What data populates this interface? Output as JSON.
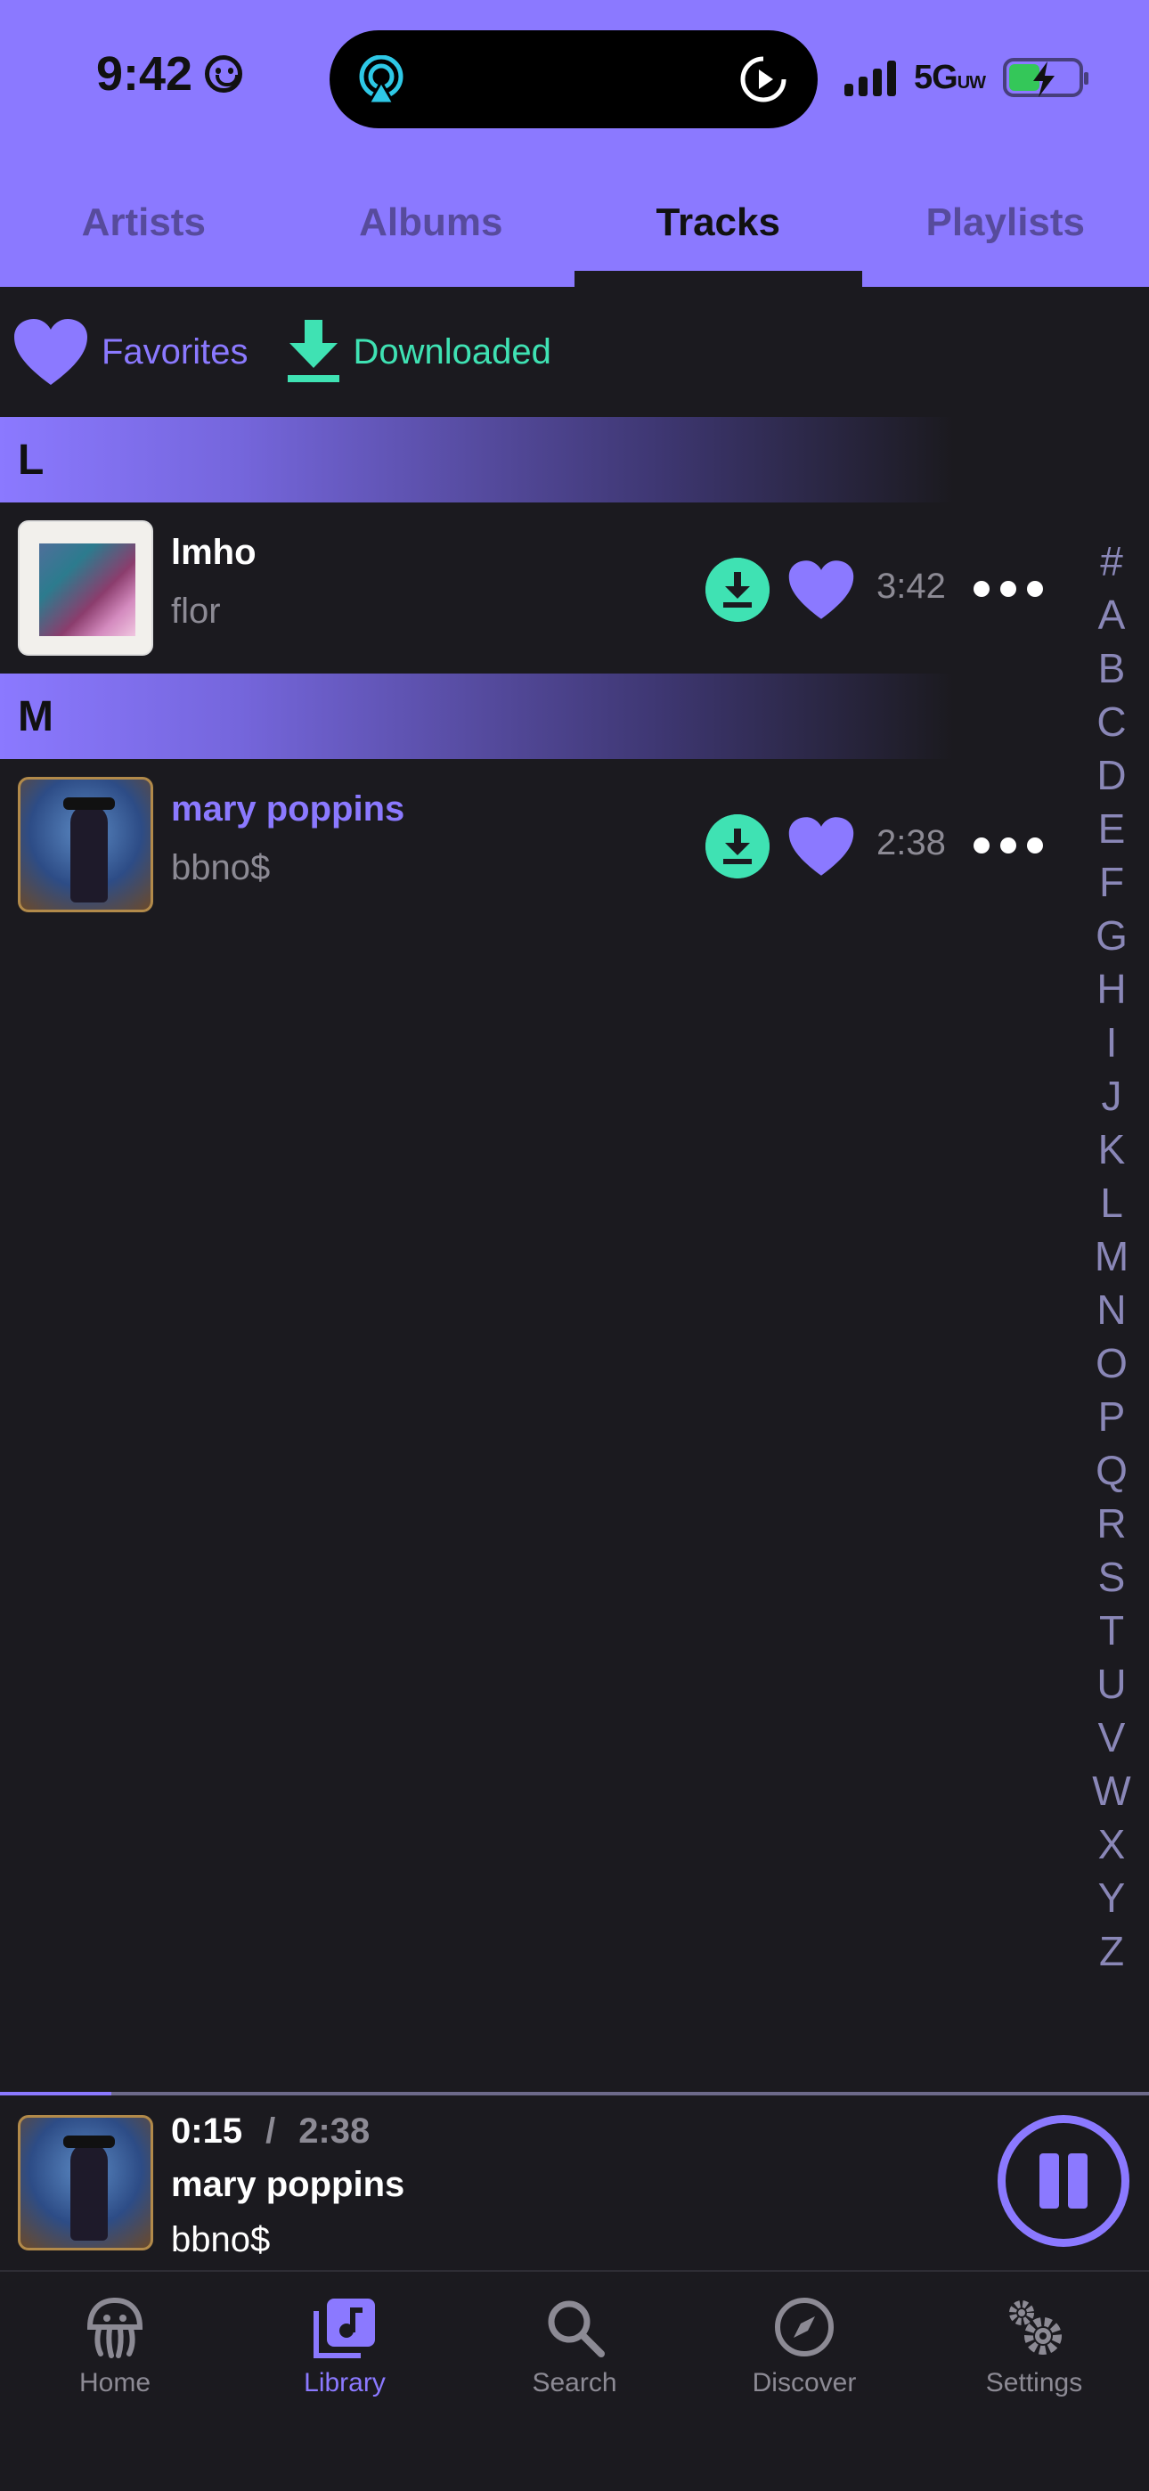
{
  "status_bar": {
    "time": "9:42",
    "network": "5G",
    "network_suffix": "UW",
    "icons": [
      "smiley-icon",
      "airplay-icon",
      "play-icon",
      "signal-icon",
      "battery-charging-icon"
    ]
  },
  "top_tabs": [
    {
      "label": "Artists",
      "active": false
    },
    {
      "label": "Albums",
      "active": false
    },
    {
      "label": "Tracks",
      "active": true
    },
    {
      "label": "Playlists",
      "active": false
    }
  ],
  "filters": {
    "favorites_label": "Favorites",
    "downloaded_label": "Downloaded"
  },
  "sections": [
    {
      "letter": "L",
      "tracks": [
        {
          "title": "lmho",
          "artist": "flor",
          "duration": "3:42",
          "downloaded": true,
          "favorite": true,
          "playing": false
        }
      ]
    },
    {
      "letter": "M",
      "tracks": [
        {
          "title": "mary poppins",
          "artist": "bbno$",
          "duration": "2:38",
          "downloaded": true,
          "favorite": true,
          "playing": true
        }
      ]
    }
  ],
  "alphabet_index": [
    "#",
    "A",
    "B",
    "C",
    "D",
    "E",
    "F",
    "G",
    "H",
    "I",
    "J",
    "K",
    "L",
    "M",
    "N",
    "O",
    "P",
    "Q",
    "R",
    "S",
    "T",
    "U",
    "V",
    "W",
    "X",
    "Y",
    "Z"
  ],
  "now_playing": {
    "elapsed": "0:15",
    "separator": "/",
    "total": "2:38",
    "progress_fraction": 0.097,
    "title": "mary poppins",
    "artist": "bbno$"
  },
  "bottom_nav": [
    {
      "label": "Home",
      "icon": "jellyfish-icon",
      "active": false
    },
    {
      "label": "Library",
      "icon": "music-library-icon",
      "active": true
    },
    {
      "label": "Search",
      "icon": "search-icon",
      "active": false
    },
    {
      "label": "Discover",
      "icon": "compass-icon",
      "active": false
    },
    {
      "label": "Settings",
      "icon": "gears-icon",
      "active": false
    }
  ],
  "colors": {
    "accent": "#8b79ff",
    "download": "#3fe2b3",
    "background": "#1b1a1f",
    "muted": "#8c8a94"
  }
}
